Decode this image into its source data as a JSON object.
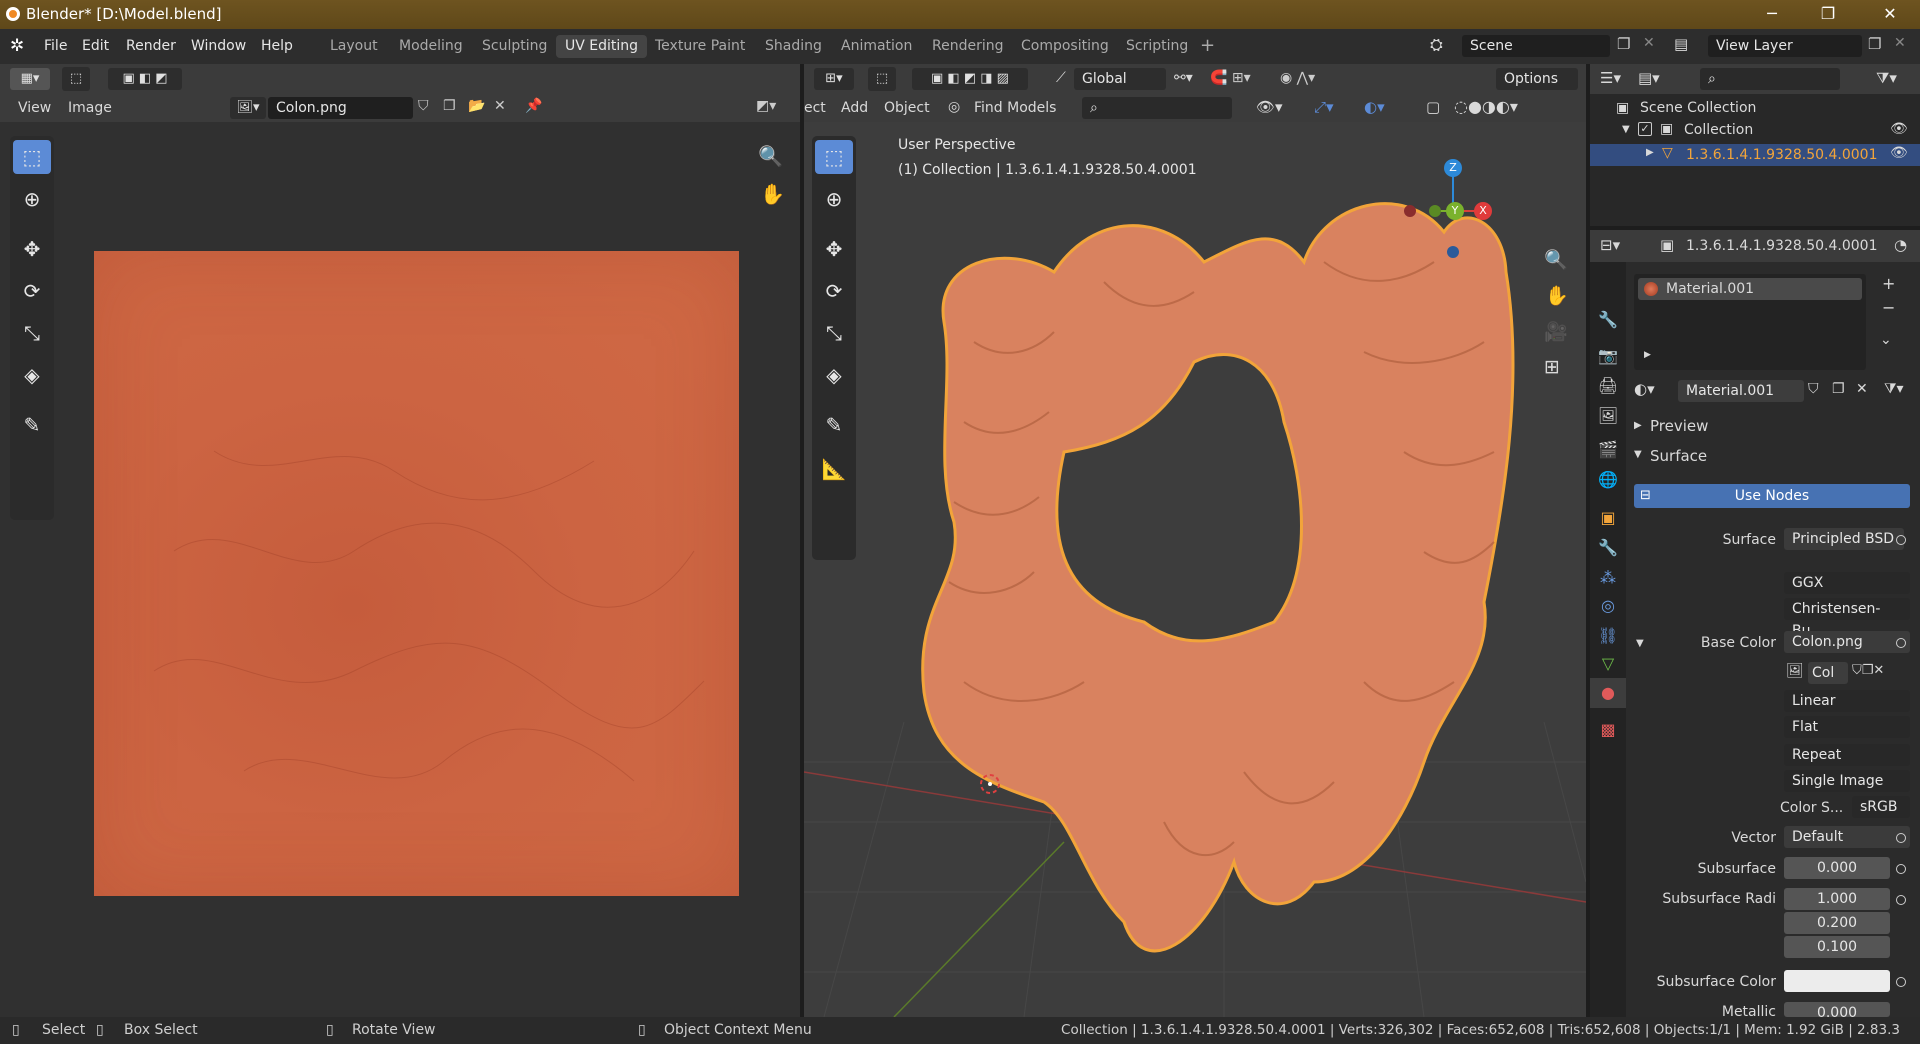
{
  "window": {
    "title": "Blender* [D:\\Model.blend]",
    "minimize": "─",
    "maximize": "❐",
    "close": "✕"
  },
  "menus": [
    "File",
    "Edit",
    "Render",
    "Window",
    "Help"
  ],
  "workspaces": [
    "Layout",
    "Modeling",
    "Sculpting",
    "UV Editing",
    "Texture Paint",
    "Shading",
    "Animation",
    "Rendering",
    "Compositing",
    "Scripting"
  ],
  "active_workspace": "UV Editing",
  "scene": {
    "scene_name": "Scene",
    "view_layer": "View Layer"
  },
  "image_editor": {
    "menu_view": "View",
    "menu_image": "Image",
    "image_name": "Colon.png"
  },
  "viewport": {
    "menu_select_partial": "ect",
    "menu_add": "Add",
    "menu_object": "Object",
    "orientation": "Global",
    "find_models": "Find Models",
    "options": "Options",
    "perspective_label": "User Perspective",
    "collection_label": "(1) Collection | 1.3.6.1.4.1.9328.50.4.0001",
    "gizmo": {
      "z": "Z",
      "y": "Y",
      "x": "X"
    }
  },
  "outliner": {
    "scene_collection": "Scene Collection",
    "collection": "Collection",
    "object": "1.3.6.1.4.1.9328.50.4.0001"
  },
  "properties": {
    "object_name": "1.3.6.1.4.1.9328.50.4.0001",
    "material_slot": "Material.001",
    "material_name": "Material.001",
    "panel_preview": "Preview",
    "panel_surface": "Surface",
    "use_nodes": "Use Nodes",
    "rows": [
      {
        "key": "Surface",
        "value": "Principled BSD",
        "type": "link"
      },
      {
        "key": "",
        "value": "GGX",
        "type": "drop"
      },
      {
        "key": "",
        "value": "Christensen-Bu...",
        "type": "drop"
      },
      {
        "key": "Base Color",
        "value": "Colon.png",
        "type": "link"
      },
      {
        "key": "",
        "value": "Linear",
        "type": "drop"
      },
      {
        "key": "",
        "value": "Flat",
        "type": "drop"
      },
      {
        "key": "",
        "value": "Repeat",
        "type": "drop"
      },
      {
        "key": "",
        "value": "Single Image",
        "type": "drop"
      }
    ],
    "image_short": "Col",
    "color_space_label": "Color S...",
    "color_space": "sRGB",
    "vector_label": "Vector",
    "vector": "Default",
    "subsurface_label": "Subsurface",
    "subsurface": "0.000",
    "subsurface_radius_label": "Subsurface Radi",
    "subsurface_radius": [
      "1.000",
      "0.200",
      "0.100"
    ],
    "subsurface_color_label": "Subsurface Color",
    "metallic_label": "Metallic",
    "metallic": "0.000"
  },
  "status": {
    "select": "Select",
    "box_select": "Box Select",
    "rotate": "Rotate View",
    "context": "Object Context Menu",
    "info": "Collection | 1.3.6.1.4.1.9328.50.4.0001 | Verts:326,302 | Faces:652,608 | Tris:652,608 | Objects:1/1 | Mem: 1.92 GiB | 2.83.3"
  },
  "colors": {
    "accent": "#5c8bd6",
    "texture": "#cb6440",
    "model": "#d9825f",
    "outline": "#f2a43a"
  }
}
